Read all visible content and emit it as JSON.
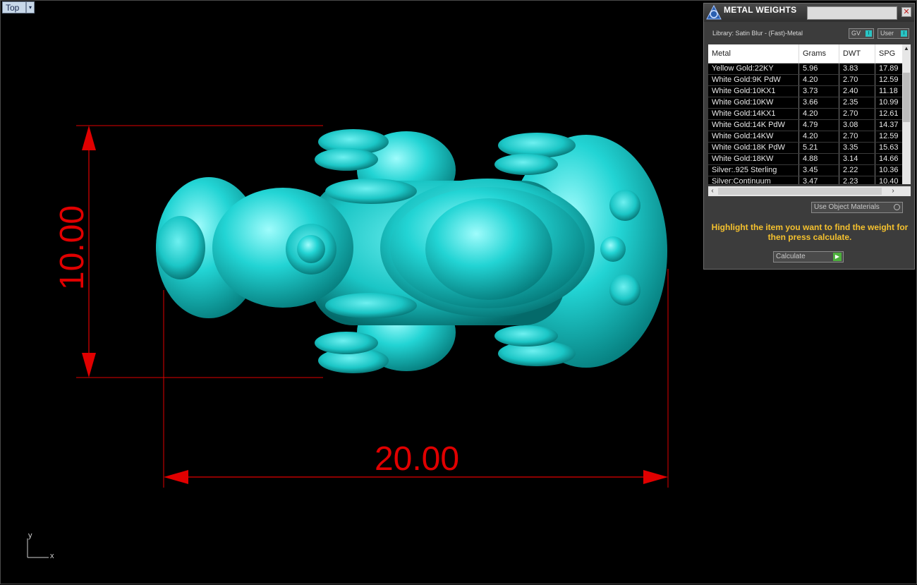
{
  "viewport": {
    "name": "Top",
    "menu_glyph": "▾",
    "axis_y": "y",
    "axis_x": "x",
    "dim_height": "10.00",
    "dim_width": "20.00",
    "dim_color": "#e00000",
    "model_color": "#22d4d4"
  },
  "panel": {
    "title": "METAL WEIGHTS",
    "close_glyph": "✕",
    "library": "Library: Satin Blur - (Fast)-Metal",
    "toggle_gv": "GV",
    "toggle_user": "User",
    "columns": [
      "Metal",
      "Grams",
      "DWT",
      "SPG"
    ],
    "rows": [
      [
        "Yellow Gold:22KY",
        "5.96",
        "3.83",
        "17.89"
      ],
      [
        "White Gold:9K PdW",
        "4.20",
        "2.70",
        "12.59"
      ],
      [
        "White Gold:10KX1",
        "3.73",
        "2.40",
        "11.18"
      ],
      [
        "White Gold:10KW",
        "3.66",
        "2.35",
        "10.99"
      ],
      [
        "White Gold:14KX1",
        "4.20",
        "2.70",
        "12.61"
      ],
      [
        "White Gold:14K PdW",
        "4.79",
        "3.08",
        "14.37"
      ],
      [
        "White Gold:14KW",
        "4.20",
        "2.70",
        "12.59"
      ],
      [
        "White Gold:18K PdW",
        "5.21",
        "3.35",
        "15.63"
      ],
      [
        "White Gold:18KW",
        "4.88",
        "3.14",
        "14.66"
      ],
      [
        "Silver:.925 Sterling",
        "3.45",
        "2.22",
        "10.36"
      ],
      [
        "Silver:Continuum",
        "3.47",
        "2.23",
        "10.40"
      ]
    ],
    "use_object_materials": "Use Object Materials",
    "hint": "Highlight the item you want to find the weight for then press calculate.",
    "calculate": "Calculate"
  }
}
